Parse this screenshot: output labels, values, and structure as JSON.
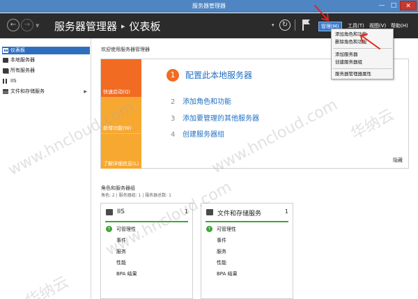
{
  "window": {
    "title": "服务器管理器",
    "min_glyph": "—",
    "max_glyph": "□",
    "close_glyph": "✕"
  },
  "header": {
    "back_glyph": "←",
    "forward_glyph": "→",
    "nav_dropdown_glyph": "▼",
    "breadcrumb_root": "服务器管理器",
    "breadcrumb_sep": "▸",
    "breadcrumb_current": "仪表板",
    "refresh_glyph": "↻",
    "caret_glyph": "▾",
    "menus": {
      "manage": "管理(M)",
      "tools": "工具(T)",
      "view": "视图(V)",
      "help": "帮助(H)"
    }
  },
  "sidebar": {
    "items": [
      {
        "label": "仪表板",
        "icon": "dashboard-icon",
        "active": true
      },
      {
        "label": "本地服务器",
        "icon": "local-server-icon",
        "active": false
      },
      {
        "label": "所有服务器",
        "icon": "all-servers-icon",
        "active": false
      },
      {
        "label": "IIS",
        "icon": "iis-icon",
        "active": false
      },
      {
        "label": "文件和存储服务",
        "icon": "storage-icon",
        "active": false
      }
    ],
    "expand_glyph": "▶"
  },
  "welcome": {
    "title": "欢迎使用服务器管理器",
    "tiles": {
      "quick_start": "快速启动(Q)",
      "new_features": "新增功能(W)",
      "learn_more": "了解详细信息(L)"
    },
    "steps": [
      {
        "num": "1",
        "label": "配置此本地服务器"
      },
      {
        "num": "2",
        "label": "添加角色和功能"
      },
      {
        "num": "3",
        "label": "添加要管理的其他服务器"
      },
      {
        "num": "4",
        "label": "创建服务器组"
      }
    ],
    "hide": "隐藏"
  },
  "roles": {
    "title": "角色和服务器组",
    "subtitle": "角色: 2 | 服务器组: 1 | 服务器总数: 1",
    "cards": [
      {
        "name": "IIS",
        "count": "1",
        "rows": [
          "可管理性",
          "事件",
          "服务",
          "性能",
          "BPA 结果"
        ]
      },
      {
        "name": "文件和存储服务",
        "count": "1",
        "rows": [
          "可管理性",
          "事件",
          "服务",
          "性能",
          "BPA 结果"
        ]
      }
    ],
    "ok_glyph": "↑"
  },
  "manage_menu": {
    "items": [
      "添加角色和功能",
      "删除角色和功能",
      "添加服务器",
      "创建服务器组",
      "服务器管理器属性"
    ]
  },
  "watermark": {
    "text_cn": "华纳云",
    "text_url": "www.hncloud.com"
  },
  "colors": {
    "accent": "#2e6fbd",
    "orange": "#f26b22",
    "tile_yellow": "#f7a830",
    "ok_green": "#3fa535",
    "annotation_red": "#e8231a"
  }
}
